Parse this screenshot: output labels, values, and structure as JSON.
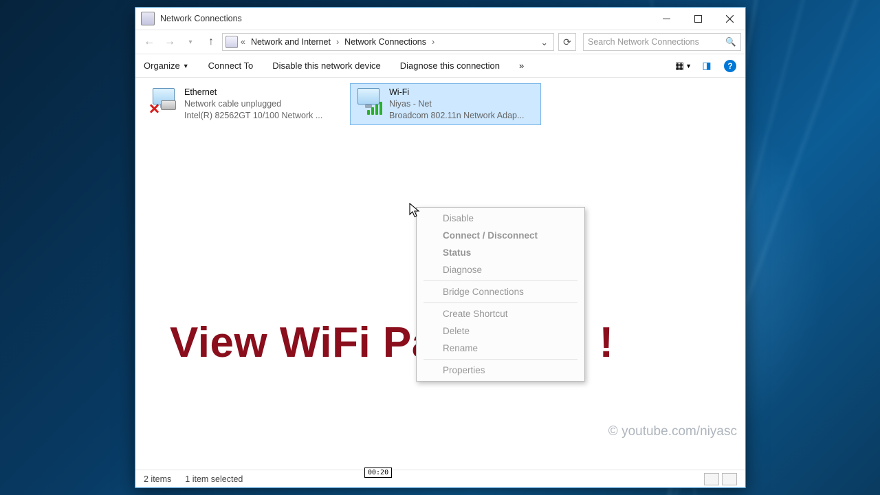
{
  "window": {
    "title": "Network Connections",
    "breadcrumb": {
      "prefix": "«",
      "items": [
        "Network and Internet",
        "Network Connections"
      ]
    },
    "search_placeholder": "Search Network Connections"
  },
  "toolbar": {
    "organize": "Organize",
    "connect": "Connect To",
    "disable": "Disable this network device",
    "diagnose": "Diagnose this connection",
    "overflow": "»"
  },
  "adapters": {
    "ethernet": {
      "name": "Ethernet",
      "status": "Network cable unplugged",
      "device": "Intel(R) 82562GT 10/100 Network ..."
    },
    "wifi": {
      "name": "Wi-Fi",
      "status": "Niyas - Net",
      "device": "Broadcom 802.11n Network Adap..."
    }
  },
  "context_menu": {
    "disable": "Disable",
    "connect": "Connect / Disconnect",
    "status": "Status",
    "diagnose": "Diagnose",
    "bridge": "Bridge Connections",
    "shortcut": "Create Shortcut",
    "delete": "Delete",
    "rename": "Rename",
    "properties": "Properties"
  },
  "overlay": {
    "headline": "View WiFi Password !",
    "watermark": "© youtube.com/niyasc"
  },
  "status": {
    "items": "2 items",
    "selected": "1 item selected"
  },
  "video": {
    "timestamp": "00:20"
  }
}
